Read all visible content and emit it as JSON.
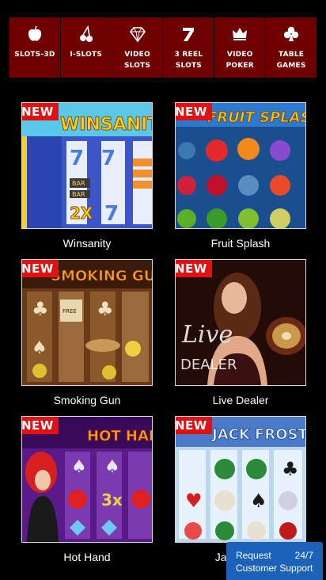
{
  "categories": [
    {
      "label": "SLOTS-3D",
      "icon": "apple-icon"
    },
    {
      "label": "I-SLOTS",
      "icon": "cherry-icon"
    },
    {
      "label": "VIDEO SLOTS",
      "icon": "diamond-icon"
    },
    {
      "label": "3 REEL SLOTS",
      "icon": "seven-icon"
    },
    {
      "label": "VIDEO POKER",
      "icon": "crown-icon"
    },
    {
      "label": "TABLE GAMES",
      "icon": "club-icon"
    }
  ],
  "badge": "NEW",
  "games": [
    {
      "name": "Winsanity"
    },
    {
      "name": "Fruit Splash"
    },
    {
      "name": "Smoking Gun"
    },
    {
      "name": "Live Dealer"
    },
    {
      "name": "Hot Hand"
    },
    {
      "name": "Jack Frost"
    }
  ],
  "support": {
    "request": "Request",
    "hours": "24/7",
    "label": "Customer Support"
  }
}
